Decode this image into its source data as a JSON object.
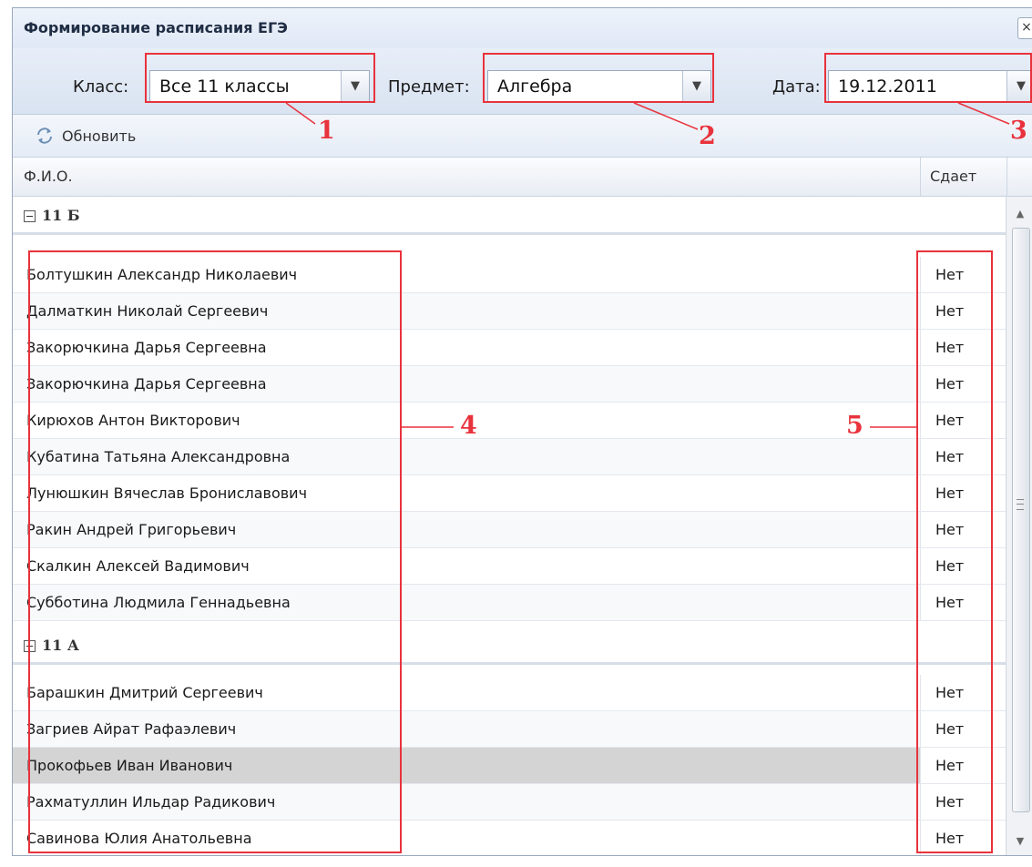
{
  "window": {
    "title": "Формирование расписания ЕГЭ",
    "close_glyph": "×"
  },
  "filters": {
    "class_label": "Класс:",
    "class_value": "Все 11 классы",
    "subject_label": "Предмет:",
    "subject_value": "Алгебра",
    "date_label": "Дата:",
    "date_value": "19.12.2011"
  },
  "toolbar": {
    "refresh_label": "Обновить",
    "refresh_icon": "refresh-icon"
  },
  "grid": {
    "columns": [
      "Ф.И.О.",
      "Сдает"
    ],
    "groups": [
      {
        "name": "11 Б",
        "rows": [
          {
            "name": "Болтушкин Александр Николаевич",
            "status": "Нет"
          },
          {
            "name": "Далматкин Николай Сергеевич",
            "status": "Нет"
          },
          {
            "name": "Закорючкина Дарья Сергеевна",
            "status": "Нет"
          },
          {
            "name": "Закорючкина Дарья Сергеевна",
            "status": "Нет"
          },
          {
            "name": "Кирюхов Антон Викторович",
            "status": "Нет"
          },
          {
            "name": "Кубатина Татьяна Александровна",
            "status": "Нет"
          },
          {
            "name": "Лунюшкин Вячеслав Брониславович",
            "status": "Нет"
          },
          {
            "name": "Ракин Андрей Григорьевич",
            "status": "Нет"
          },
          {
            "name": "Скалкин Алексей Вадимович",
            "status": "Нет"
          },
          {
            "name": "Субботина Людмила Геннадьевна",
            "status": "Нет"
          }
        ]
      },
      {
        "name": "11 А",
        "rows": [
          {
            "name": "Барашкин Дмитрий Сергеевич",
            "status": "Нет"
          },
          {
            "name": "Загриев Айрат Рафаэлевич",
            "status": "Нет"
          },
          {
            "name": "Прокофьев Иван Иванович",
            "status": "Нет",
            "selected": true
          },
          {
            "name": "Рахматуллин Ильдар Радикович",
            "status": "Нет"
          },
          {
            "name": "Савинова Юлия Анатольевна",
            "status": "Нет"
          }
        ]
      }
    ]
  },
  "annotations": [
    "1",
    "2",
    "3",
    "4",
    "5"
  ],
  "colors": {
    "annotation": "#e8323c",
    "selected_row": "#d4d4d4",
    "header_bg": "#dfe8f6"
  }
}
